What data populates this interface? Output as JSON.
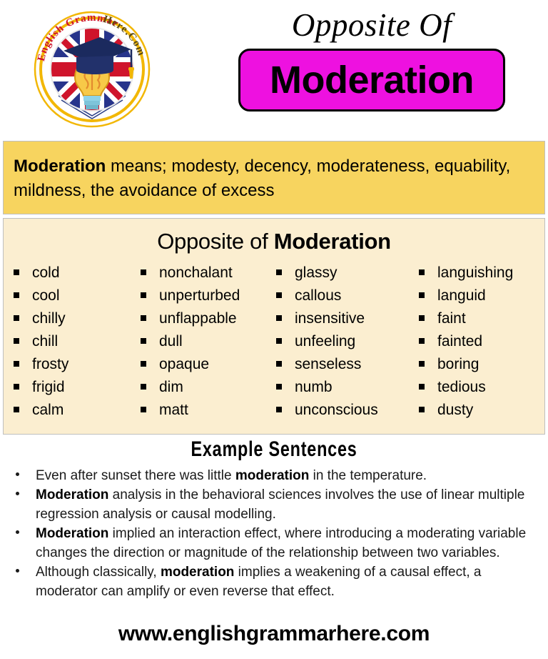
{
  "header": {
    "logo": {
      "name": "english-grammar-here-logo",
      "curved_text_left": "English Grammar",
      "curved_text_right": "Here.Com",
      "ring_color": "#f2b705",
      "flag": "union-jack"
    },
    "kicker": "Opposite Of",
    "word": "Moderation",
    "badge_color": "#ee11e0",
    "badge_border_color": "#000000"
  },
  "definition": {
    "term": "Moderation",
    "rest": " means; modesty, decency, moderateness, equability, mildness, the avoidance of excess",
    "background_color": "#f7d45f"
  },
  "wordlist": {
    "heading_prefix": "Opposite of ",
    "heading_term": "Moderation",
    "background_color": "#fbeed0",
    "columns": [
      [
        "cold",
        "cool",
        "chilly",
        "chill",
        "frosty",
        "frigid",
        "calm"
      ],
      [
        "nonchalant",
        "unperturbed",
        "unflappable",
        "dull",
        "opaque",
        "dim",
        "matt"
      ],
      [
        "glassy",
        "callous",
        "insensitive",
        "unfeeling",
        "senseless",
        "numb",
        "unconscious"
      ],
      [
        "languishing",
        "languid",
        "faint",
        "fainted",
        "boring",
        "tedious",
        "dusty"
      ]
    ]
  },
  "examples": {
    "heading": "Example  Sentences",
    "items": [
      [
        {
          "t": "Even after sunset there was little ",
          "b": false
        },
        {
          "t": "moderation",
          "b": true
        },
        {
          "t": " in the temperature.",
          "b": false
        }
      ],
      [
        {
          "t": "Moderation",
          "b": true
        },
        {
          "t": " analysis in the behavioral sciences involves the use of linear multiple regression analysis or causal modelling.",
          "b": false
        }
      ],
      [
        {
          "t": "Moderation",
          "b": true
        },
        {
          "t": " implied an interaction effect, where introducing a moderating variable changes the direction or magnitude of the relationship between two variables.",
          "b": false
        }
      ],
      [
        {
          "t": "Although classically, ",
          "b": false
        },
        {
          "t": "moderation",
          "b": true
        },
        {
          "t": " implies a weakening of a causal effect, a moderator can amplify or even reverse that effect.",
          "b": false
        }
      ]
    ]
  },
  "footer": {
    "url": "www.englishgrammarhere.com"
  }
}
